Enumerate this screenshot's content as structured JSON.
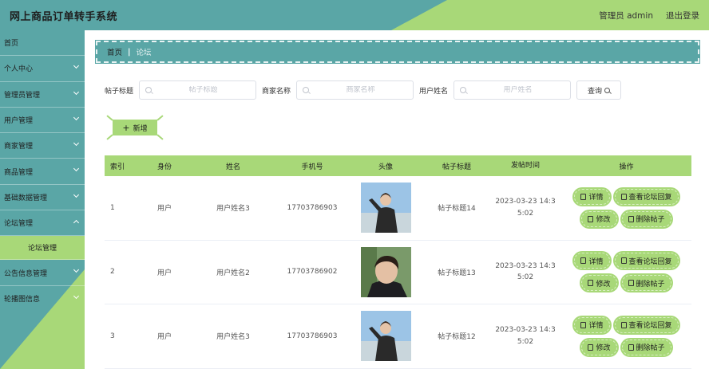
{
  "app": {
    "title": "网上商品订单转手系统"
  },
  "header": {
    "user": "管理员 admin",
    "logout": "退出登录"
  },
  "colors": {
    "teal": "#5aa6a6",
    "green": "#a8d878"
  },
  "sidebar": {
    "items": [
      {
        "label": "首页"
      },
      {
        "label": "个人中心"
      },
      {
        "label": "管理员管理"
      },
      {
        "label": "用户管理"
      },
      {
        "label": "商家管理"
      },
      {
        "label": "商品管理"
      },
      {
        "label": "基础数据管理"
      },
      {
        "label": "论坛管理"
      },
      {
        "label": "论坛管理"
      },
      {
        "label": "公告信息管理"
      },
      {
        "label": "轮播图信息"
      }
    ]
  },
  "breadcrumb": {
    "home": "首页",
    "separator": "|",
    "current": "论坛"
  },
  "search": {
    "title_label": "帖子标题",
    "title_placeholder": "帖子标题",
    "merchant_label": "商家名称",
    "merchant_placeholder": "商家名称",
    "user_label": "用户姓名",
    "user_placeholder": "用户姓名",
    "query": "查询"
  },
  "toolbar": {
    "add": "新增"
  },
  "table": {
    "headers": [
      "索引",
      "身份",
      "姓名",
      "手机号",
      "头像",
      "帖子标题",
      "发帖时间",
      "操作"
    ],
    "rows": [
      {
        "index": "1",
        "role": "用户",
        "name": "用户姓名3",
        "phone": "17703786903",
        "title": "帖子标题14",
        "time1": "2023-03-23 14:3",
        "time2": "5:02"
      },
      {
        "index": "2",
        "role": "用户",
        "name": "用户姓名2",
        "phone": "17703786902",
        "title": "帖子标题13",
        "time1": "2023-03-23 14:3",
        "time2": "5:02"
      },
      {
        "index": "3",
        "role": "用户",
        "name": "用户姓名3",
        "phone": "17703786903",
        "title": "帖子标题12",
        "time1": "2023-03-23 14:3",
        "time2": "5:02"
      }
    ],
    "ops": {
      "detail": "详情",
      "replies": "查看论坛回复",
      "edit": "修改",
      "delete": "删除帖子"
    }
  }
}
